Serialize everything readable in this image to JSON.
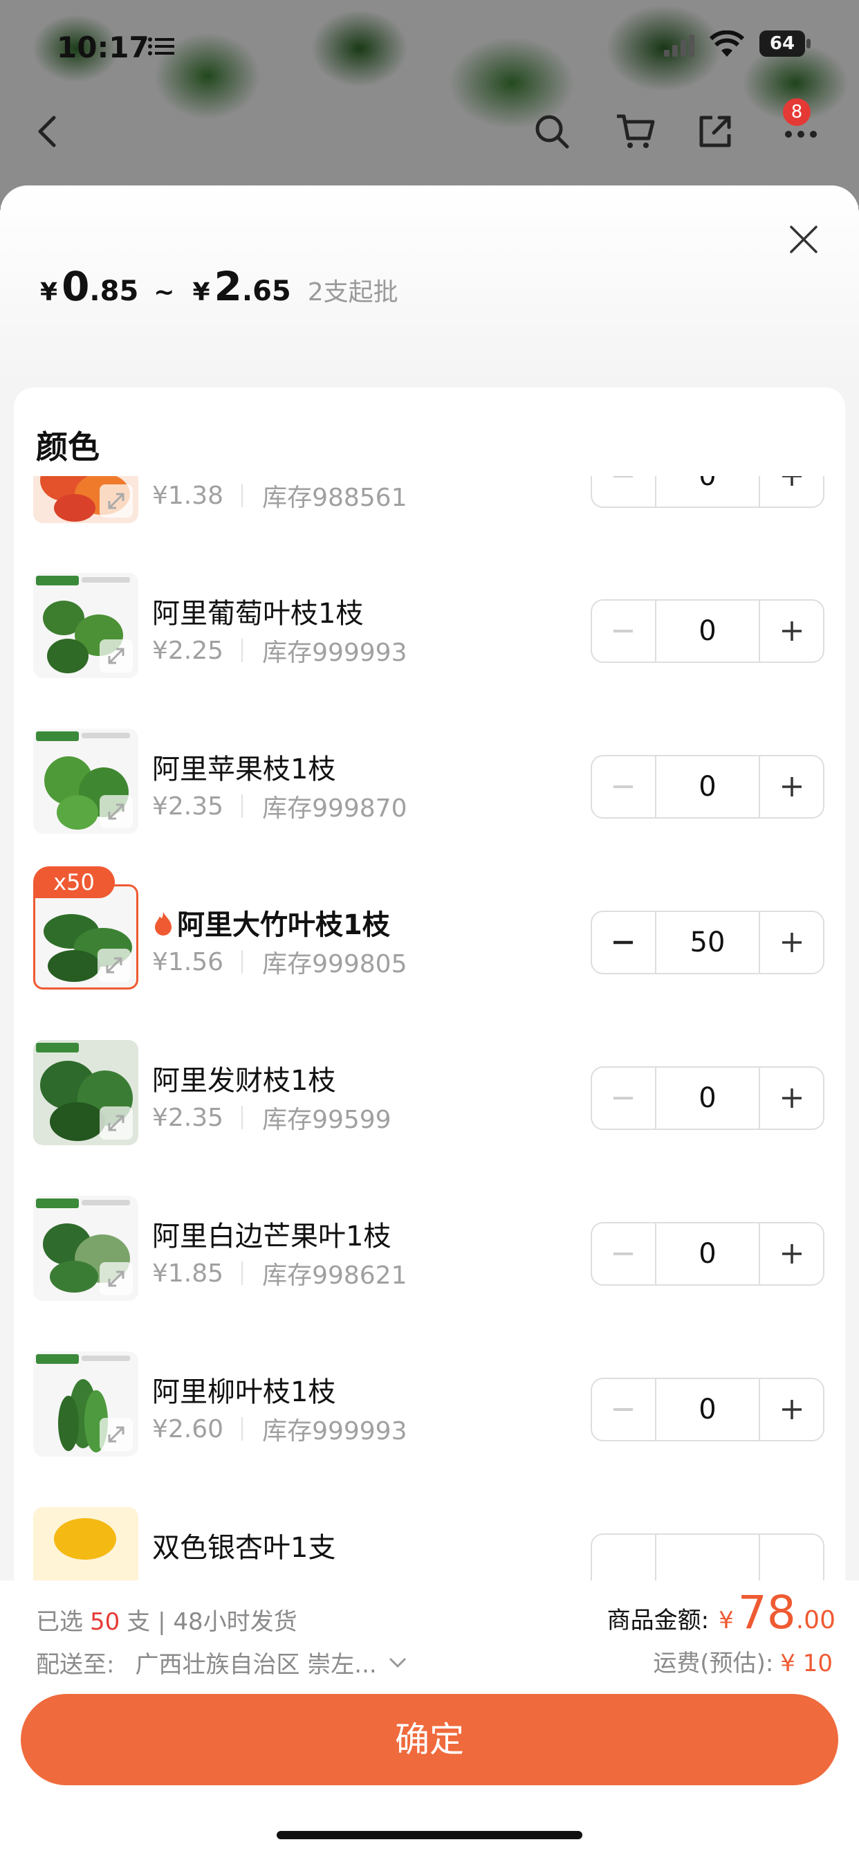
{
  "status_bar": {
    "time": "10:17",
    "battery": "64"
  },
  "nav": {
    "cart_badge": "8"
  },
  "header": {
    "price_min_currency": "¥",
    "price_min_int": "0",
    "price_min_dec": ".85",
    "tilde": "~",
    "price_max_currency": "¥",
    "price_max_int": "2",
    "price_max_dec": ".65",
    "min_order": "2支起批"
  },
  "section": {
    "title": "颜色"
  },
  "items": [
    {
      "name": "",
      "price": "¥1.38",
      "stock": "库存988561",
      "qty": "0"
    },
    {
      "name": "阿里葡萄叶枝1枝",
      "price": "¥2.25",
      "stock": "库存999993",
      "qty": "0"
    },
    {
      "name": "阿里苹果枝1枝",
      "price": "¥2.35",
      "stock": "库存999870",
      "qty": "0"
    },
    {
      "name": "阿里大竹叶枝1枝",
      "price": "¥1.56",
      "stock": "库存999805",
      "qty": "50",
      "badge": "x50"
    },
    {
      "name": "阿里发财枝1枝",
      "price": "¥2.35",
      "stock": "库存99599",
      "qty": "0"
    },
    {
      "name": "阿里白边芒果叶1枝",
      "price": "¥1.85",
      "stock": "库存998621",
      "qty": "0"
    },
    {
      "name": "阿里柳叶枝1枝",
      "price": "¥2.60",
      "stock": "库存999993",
      "qty": "0"
    },
    {
      "name": "双色银杏叶1支",
      "price": "",
      "stock": "",
      "qty": ""
    }
  ],
  "footer": {
    "selected_prefix": "已选",
    "selected_count": "50",
    "selected_suffix": "支 | 48小时发货",
    "ship_label": "配送至:",
    "ship_address": "广西壮族自治区 崇左...",
    "amount_label": "商品金额:",
    "amount_currency": "¥",
    "amount_int": "78",
    "amount_dec": ".00",
    "freight_label": "运费(预估):",
    "freight_value": "¥ 10",
    "confirm": "确定"
  },
  "colors": {
    "accent": "#ef6a3c",
    "badge": "#e53935",
    "selected_border": "#ef5a32"
  },
  "icons": [
    "back-icon",
    "search-icon",
    "cart-icon",
    "share-icon",
    "more-icon",
    "close-icon",
    "expand-icon",
    "minus-icon",
    "plus-icon",
    "flame-icon",
    "chevron-down-icon",
    "wifi-icon",
    "signal-icon",
    "list-icon"
  ]
}
